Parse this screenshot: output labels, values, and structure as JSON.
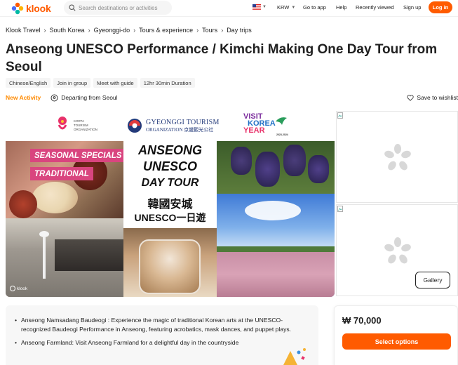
{
  "colors": {
    "brand": "#ff5b00",
    "accent_new": "#ff8a00"
  },
  "header": {
    "logo_text": "klook",
    "search_placeholder": "Search destinations or activities",
    "currency": "KRW",
    "nav": [
      "Go to app",
      "Help",
      "Recently viewed",
      "Sign up"
    ],
    "login": "Log in"
  },
  "breadcrumb": [
    "Klook Travel",
    "South Korea",
    "Gyeonggi-do",
    "Tours & experience",
    "Tours",
    "Day trips"
  ],
  "title": "Anseong UNESCO Performance / Kimchi Making One Day Tour from Seoul",
  "tags": [
    "Chinese/English",
    "Join in group",
    "Meet with guide",
    "12hr 30min Duration"
  ],
  "subrow": {
    "new_activity": "New Activity",
    "departing": "Departing from Seoul",
    "wishlist": "Save to wishlist"
  },
  "banner": {
    "logo1_lines": [
      "KORTA",
      "TOURISM",
      "ORGANIZATION"
    ],
    "logo2_lines": [
      "GYEONGGI TOURISM",
      "ORGANIZATION 京畿觀光公社"
    ],
    "logo3_lines": [
      "VISIT",
      "KOREA",
      "YEAR",
      "2023-2024"
    ],
    "left_labels": [
      "SEASONAL SPECIALS",
      "TRADITIONAL"
    ],
    "center_lines": [
      "ANSEONG",
      "UNESCO",
      "DAY TOUR",
      "韓國安城",
      "UNESCO一日遊"
    ],
    "watermark": "klook"
  },
  "gallery_button": "Gallery",
  "description": [
    "Anseong Namsadang Baudeogi : Experience the magic of traditional Korean arts at the UNESCO-recognized Baudeogi Performance in Anseong, featuring acrobatics, mask dances, and puppet plays.",
    "Anseong Farmland: Visit Anseong Farmland for a delightful day in the countryside"
  ],
  "price": "₩ 70,000",
  "select_options": "Select options"
}
